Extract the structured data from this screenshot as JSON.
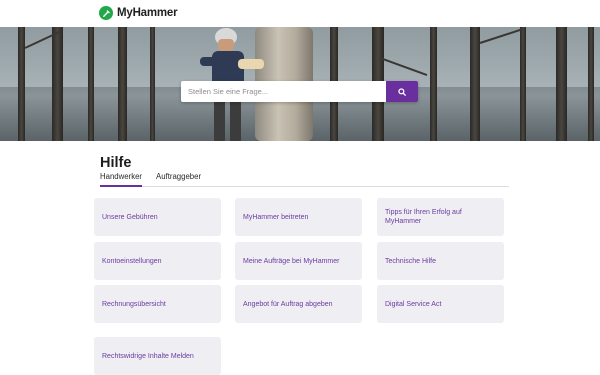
{
  "brand": {
    "name": "MyHammer",
    "accent": "#6a2f9e",
    "logo_color": "#22a84a"
  },
  "search": {
    "placeholder": "Stellen Sie eine Frage...",
    "value": "",
    "button_icon": "search-icon"
  },
  "page": {
    "title": "Hilfe"
  },
  "tabs": [
    {
      "label": "Handwerker",
      "active": true
    },
    {
      "label": "Auftraggeber",
      "active": false
    }
  ],
  "cards": [
    {
      "label": "Unsere Gebühren"
    },
    {
      "label": "MyHammer beitreten"
    },
    {
      "label": "Tipps für Ihren Erfolg auf MyHammer"
    },
    {
      "label": "Kontoeinstellungen"
    },
    {
      "label": "Meine Aufträge bei MyHammer"
    },
    {
      "label": "Technische Hilfe"
    },
    {
      "label": "Rechnungsübersicht"
    },
    {
      "label": "Angebot für Auftrag abgeben"
    },
    {
      "label": "Digital Service Act"
    },
    {
      "label": "Rechtswidrige Inhalte Melden"
    }
  ]
}
